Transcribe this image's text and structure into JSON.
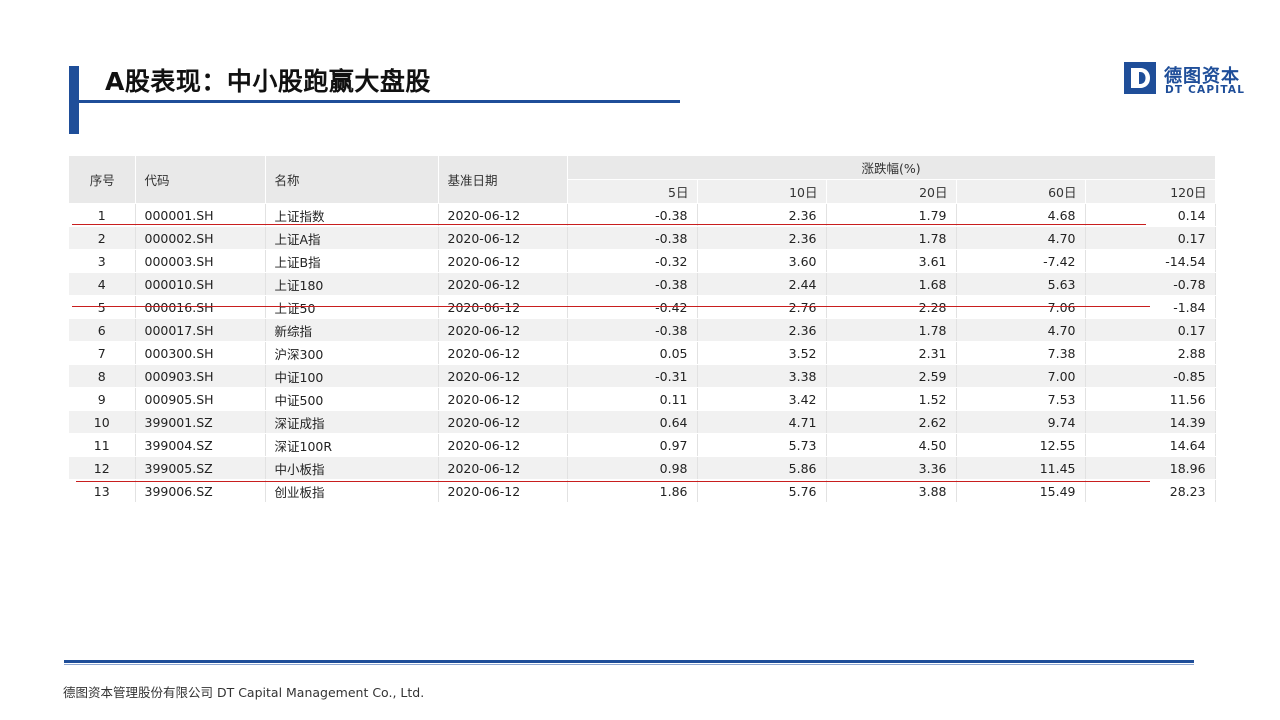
{
  "title": "A股表现：中小股跑赢大盘股",
  "logo": {
    "cn": "德图资本",
    "en": "DT CAPITAL"
  },
  "table": {
    "headers": {
      "idx": "序号",
      "code": "代码",
      "name": "名称",
      "date": "基准日期",
      "group": "涨跌幅(%)"
    },
    "periods": [
      "5日",
      "10日",
      "20日",
      "60日",
      "120日"
    ],
    "rows": [
      [
        "1",
        "000001.SH",
        "上证指数",
        "2020-06-12",
        "-0.38",
        "2.36",
        "1.79",
        "4.68",
        "0.14"
      ],
      [
        "2",
        "000002.SH",
        "上证A指",
        "2020-06-12",
        "-0.38",
        "2.36",
        "1.78",
        "4.70",
        "0.17"
      ],
      [
        "3",
        "000003.SH",
        "上证B指",
        "2020-06-12",
        "-0.32",
        "3.60",
        "3.61",
        "-7.42",
        "-14.54"
      ],
      [
        "4",
        "000010.SH",
        "上证180",
        "2020-06-12",
        "-0.38",
        "2.44",
        "1.68",
        "5.63",
        "-0.78"
      ],
      [
        "5",
        "000016.SH",
        "上证50",
        "2020-06-12",
        "-0.42",
        "2.76",
        "2.28",
        "7.06",
        "-1.84"
      ],
      [
        "6",
        "000017.SH",
        "新综指",
        "2020-06-12",
        "-0.38",
        "2.36",
        "1.78",
        "4.70",
        "0.17"
      ],
      [
        "7",
        "000300.SH",
        "沪深300",
        "2020-06-12",
        "0.05",
        "3.52",
        "2.31",
        "7.38",
        "2.88"
      ],
      [
        "8",
        "000903.SH",
        "中证100",
        "2020-06-12",
        "-0.31",
        "3.38",
        "2.59",
        "7.00",
        "-0.85"
      ],
      [
        "9",
        "000905.SH",
        "中证500",
        "2020-06-12",
        "0.11",
        "3.42",
        "1.52",
        "7.53",
        "11.56"
      ],
      [
        "10",
        "399001.SZ",
        "深证成指",
        "2020-06-12",
        "0.64",
        "4.71",
        "2.62",
        "9.74",
        "14.39"
      ],
      [
        "11",
        "399004.SZ",
        "深证100R",
        "2020-06-12",
        "0.97",
        "5.73",
        "4.50",
        "12.55",
        "14.64"
      ],
      [
        "12",
        "399005.SZ",
        "中小板指",
        "2020-06-12",
        "0.98",
        "5.86",
        "3.36",
        "11.45",
        "18.96"
      ],
      [
        "13",
        "399006.SZ",
        "创业板指",
        "2020-06-12",
        "1.86",
        "5.76",
        "3.88",
        "15.49",
        "28.23"
      ]
    ]
  },
  "footer": "德图资本管理股份有限公司 DT Capital Management Co., Ltd.",
  "colors": {
    "brand": "#1f4e99",
    "highlight_line": "#c81e1e"
  }
}
